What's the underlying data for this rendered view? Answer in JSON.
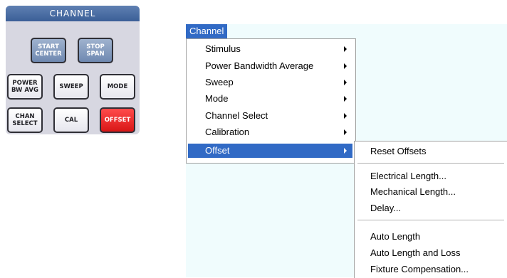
{
  "hardkey_panel": {
    "title": "CHANNEL",
    "keys": {
      "start_center": "START\nCENTER",
      "stop_span": "STOP\nSPAN",
      "power_bw_avg": "POWER\nBW AVG",
      "sweep": "SWEEP",
      "mode": "MODE",
      "chan_select": "CHAN\nSELECT",
      "cal": "CAL",
      "offset": "OFFSET"
    }
  },
  "menubar": {
    "title": "Channel"
  },
  "main_menu": {
    "items": [
      {
        "label": "Stimulus",
        "has_submenu": true
      },
      {
        "label": "Power Bandwidth Average",
        "has_submenu": true
      },
      {
        "label": "Sweep",
        "has_submenu": true
      },
      {
        "label": "Mode",
        "has_submenu": true
      },
      {
        "label": "Channel Select",
        "has_submenu": true
      },
      {
        "label": "Calibration",
        "has_submenu": true
      },
      {
        "label": "Offset",
        "has_submenu": true,
        "selected": true
      }
    ]
  },
  "offset_submenu": {
    "items": [
      {
        "label": "Reset Offsets"
      },
      {
        "label": "Electrical Length..."
      },
      {
        "label": "Mechanical Length..."
      },
      {
        "label": "Delay..."
      },
      {
        "label": "Auto Length"
      },
      {
        "label": "Auto Length and Loss"
      },
      {
        "label": "Fixture Compensation..."
      }
    ]
  },
  "colors": {
    "menu_highlight": "#316ac5",
    "offset_key": "#e61e1e",
    "app_background": "#f0fcfd",
    "panel_title": "#4a6da4"
  }
}
